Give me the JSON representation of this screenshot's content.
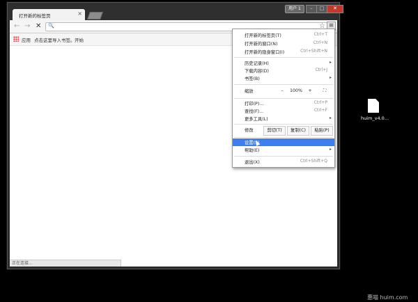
{
  "tab": {
    "title": "打开新的标签页",
    "close": "×"
  },
  "window_controls": {
    "user": "用户 1",
    "minimize": "–",
    "maximize": "□",
    "close": "✕"
  },
  "toolbar": {
    "back": "←",
    "forward": "→",
    "stop": "✕",
    "search_glyph": "🔍",
    "star": "☆",
    "menu": "≡"
  },
  "bookmarks": {
    "apps": "应用",
    "import_hint": "点击这里导入书签。",
    "start": "开始"
  },
  "status_text": "正在连接...",
  "menu": {
    "group1": [
      {
        "label": "打开新的标签页(T)",
        "shortcut": "Ctrl+T"
      },
      {
        "label": "打开新的窗口(N)",
        "shortcut": "Ctrl+N"
      },
      {
        "label": "打开新的隐身窗口(I)",
        "shortcut": "Ctrl+Shift+N"
      }
    ],
    "group2": [
      {
        "label": "历史记录(H)",
        "arrow": "▸"
      },
      {
        "label": "下载内容(D)",
        "shortcut": "Ctrl+J"
      },
      {
        "label": "书签(B)",
        "arrow": "▸"
      }
    ],
    "zoom": {
      "label": "缩放",
      "minus": "–",
      "value": "100%",
      "plus": "+",
      "fullscreen": "⛶"
    },
    "group3": [
      {
        "label": "打印(P)...",
        "shortcut": "Ctrl+P"
      },
      {
        "label": "查找(F)...",
        "shortcut": "Ctrl+F"
      },
      {
        "label": "更多工具(L)",
        "arrow": "▸"
      }
    ],
    "edit": {
      "label": "修改",
      "cut": "剪切(T)",
      "copy": "复制(C)",
      "paste": "粘贴(P)"
    },
    "group4": [
      {
        "label": "设置(S)"
      },
      {
        "label": "帮助(E)",
        "arrow": "▸"
      }
    ],
    "exit": {
      "label": "退出(X)",
      "shortcut": "Ctrl+Shift+Q"
    }
  },
  "desktop": {
    "file_label": "huim_v4.0..."
  },
  "watermark": "惠喵 huim.com",
  "colors": {
    "highlight": "#3d7ef0",
    "desktop": "#000000"
  }
}
